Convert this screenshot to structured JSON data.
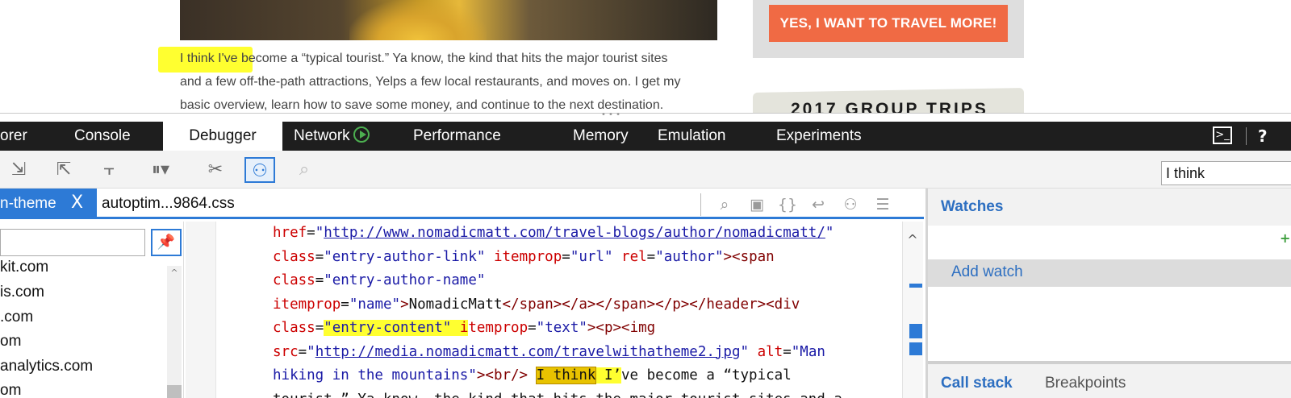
{
  "webpage": {
    "article_lines": [
      "I think I've become a “typical tourist.” Ya know, the kind that hits the major tourist sites",
      "and a few off-the-path attractions, Yelps a few local restaurants, and moves on. I get my",
      "basic overview, learn how to save some money, and continue to the next destination."
    ],
    "cta_label": "YES, I WANT TO TRAVEL MORE!",
    "group_trips_title": "2017 GROUP TRIPS"
  },
  "devtools": {
    "tabs": [
      "orer",
      "Console",
      "Debugger",
      "Network",
      "Performance",
      "Memory",
      "Emulation",
      "Experiments"
    ],
    "active_tab": "Debugger",
    "help_label": "?",
    "console_toggle_label": ">_",
    "find_value": "I think",
    "doc_tabs": {
      "active": "n-theme",
      "close_label": "X",
      "file": "autoptim...9864.css"
    },
    "tree_items": [
      "kit.com",
      "is.com",
      ".com",
      "om",
      "analytics.com",
      "om"
    ],
    "code_lines": [
      [
        {
          "c": "at",
          "t": "href"
        },
        {
          "c": "tx",
          "t": "="
        },
        {
          "c": "st",
          "t": "\""
        },
        {
          "c": "ur",
          "t": "http://www.nomadicmatt.com/travel-blogs/author/nomadicmatt/"
        },
        {
          "c": "st",
          "t": "\""
        }
      ],
      [
        {
          "c": "at",
          "t": "class"
        },
        {
          "c": "tx",
          "t": "="
        },
        {
          "c": "st",
          "t": "\"entry-author-link\""
        },
        {
          "c": "tx",
          "t": " "
        },
        {
          "c": "at",
          "t": "itemprop"
        },
        {
          "c": "tx",
          "t": "="
        },
        {
          "c": "st",
          "t": "\"url\""
        },
        {
          "c": "tx",
          "t": " "
        },
        {
          "c": "at",
          "t": "rel"
        },
        {
          "c": "tx",
          "t": "="
        },
        {
          "c": "st",
          "t": "\"author\""
        },
        {
          "c": "tg",
          "t": "><span"
        }
      ],
      [
        {
          "c": "at",
          "t": "class"
        },
        {
          "c": "tx",
          "t": "="
        },
        {
          "c": "st",
          "t": "\"entry-author-name\""
        }
      ],
      [
        {
          "c": "at",
          "t": "itemprop"
        },
        {
          "c": "tx",
          "t": "="
        },
        {
          "c": "st",
          "t": "\"name\""
        },
        {
          "c": "tg",
          "t": ">"
        },
        {
          "c": "tx",
          "t": "NomadicMatt"
        },
        {
          "c": "tg",
          "t": "</span></a></span></p></header><div"
        }
      ],
      [
        {
          "c": "at",
          "t": "class"
        },
        {
          "c": "tx",
          "t": "="
        },
        {
          "c": "st hl",
          "t": "\"entry-content\" "
        },
        {
          "c": "at hl",
          "t": "i"
        },
        {
          "c": "at",
          "t": "temprop"
        },
        {
          "c": "tx",
          "t": "="
        },
        {
          "c": "st",
          "t": "\"text\""
        },
        {
          "c": "tg",
          "t": "><p><img"
        }
      ],
      [
        {
          "c": "at",
          "t": "src"
        },
        {
          "c": "tx",
          "t": "="
        },
        {
          "c": "st",
          "t": "\""
        },
        {
          "c": "ur",
          "t": "http://media.nomadicmatt.com/travelwithatheme2.jpg"
        },
        {
          "c": "st",
          "t": "\""
        },
        {
          "c": "tx",
          "t": " "
        },
        {
          "c": "at",
          "t": "alt"
        },
        {
          "c": "tx",
          "t": "="
        },
        {
          "c": "st",
          "t": "\"Man"
        }
      ],
      [
        {
          "c": "st",
          "t": "hiking in the mountains\""
        },
        {
          "c": "tg",
          "t": "><br/>"
        },
        {
          "c": "tx",
          "t": " "
        },
        {
          "c": "tx hl-find",
          "t": "I think"
        },
        {
          "c": "tx hl",
          "t": " I’"
        },
        {
          "c": "tx",
          "t": "ve become a “typical"
        }
      ],
      [
        {
          "c": "tx",
          "t": "tourist.” Ya know, the kind that hits the major tourist sites and a"
        }
      ]
    ],
    "watches_title": "Watches",
    "add_watch_label": "Add watch",
    "bottom_tabs": {
      "call_stack": "Call stack",
      "breakpoints": "Breakpoints"
    }
  },
  "colors": {
    "accent": "#2d7ad6",
    "cta": "#f06a44",
    "highlight": "#ffff30",
    "tabbar": "#1e1e1e"
  }
}
